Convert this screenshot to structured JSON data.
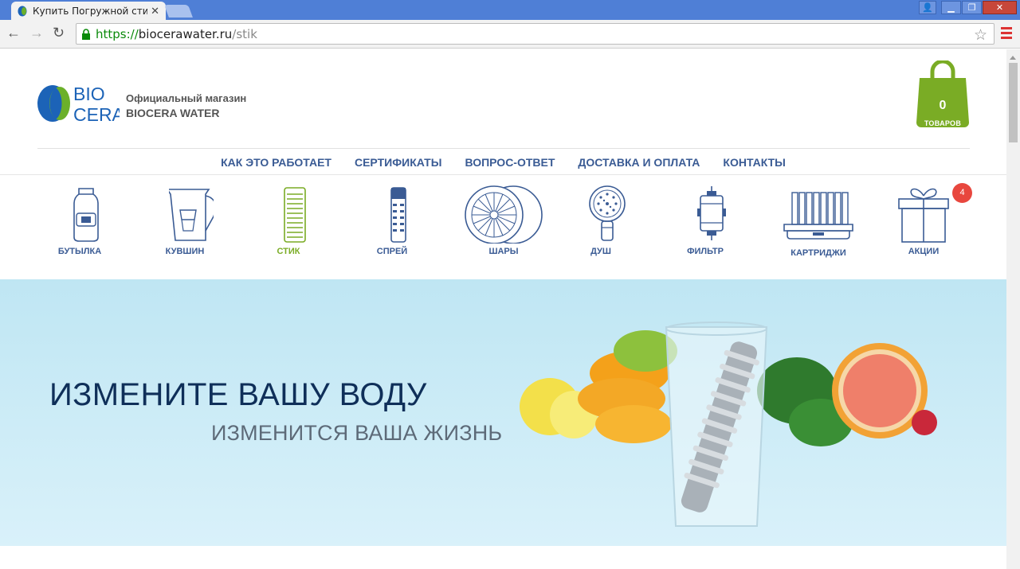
{
  "browser": {
    "tab_title": "Купить Погружной стик |",
    "url_protocol": "https://",
    "url_host": "biocerawater.ru",
    "url_path": "/stik",
    "accent": "#4f7fd6"
  },
  "header": {
    "logo_bio": "BIO",
    "logo_cera": "CERA",
    "tagline_1": "Официальный магазин",
    "tagline_2": "BIOCERA WATER",
    "cart_count": "0",
    "cart_label": "ТОВАРОВ",
    "cart_color": "#7aac25"
  },
  "nav": [
    "КАК ЭТО РАБОТАЕТ",
    "СЕРТИФИКАТЫ",
    "ВОПРОС-ОТВЕТ",
    "ДОСТАВКА И ОПЛАТА",
    "КОНТАКТЫ"
  ],
  "categories": [
    {
      "label": "БУТЫЛКА",
      "icon": "bottle-icon"
    },
    {
      "label": "КУВШИН",
      "icon": "pitcher-icon"
    },
    {
      "label": "СТИК",
      "icon": "stick-icon",
      "active": true
    },
    {
      "label": "СПРЕЙ",
      "icon": "spray-icon"
    },
    {
      "label": "ШАРЫ",
      "icon": "balls-icon"
    },
    {
      "label": "ДУШ",
      "icon": "shower-icon"
    },
    {
      "label": "ФИЛЬТР",
      "icon": "filter-icon"
    },
    {
      "label": "КАРТРИДЖИ",
      "icon": "cartridges-icon"
    },
    {
      "label": "АКЦИИ",
      "icon": "gift-icon"
    }
  ],
  "promo_badge": "4",
  "hero": {
    "headline": "ИЗМЕНИТЕ ВАШУ ВОДУ",
    "subheadline": "ИЗМЕНИТСЯ ВАША ЖИЗНЬ"
  }
}
